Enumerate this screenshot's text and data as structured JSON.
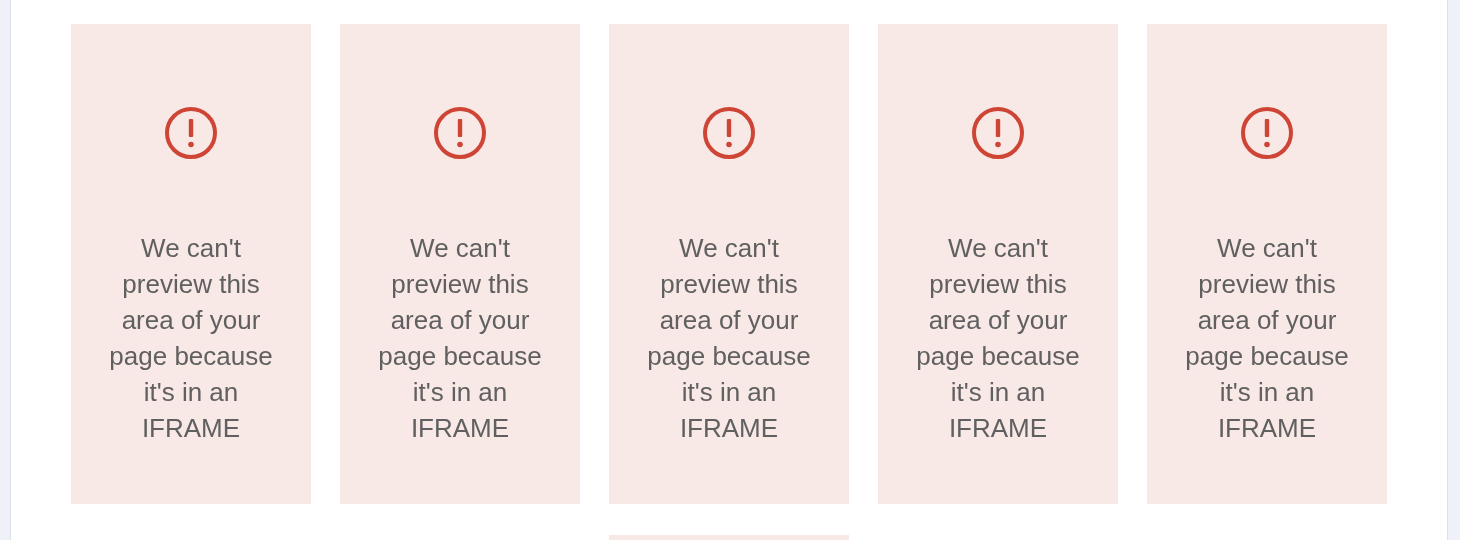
{
  "cards": [
    {
      "kind": "notice",
      "message": "We can't preview this area of your page because it's in an IFRAME"
    },
    {
      "kind": "notice",
      "message": "We can't preview this area of your page because it's in an IFRAME"
    },
    {
      "kind": "notice",
      "message": "We can't preview this area of your page because it's in an IFRAME"
    },
    {
      "kind": "notice",
      "message": "We can't preview this area of your page because it's in an IFRAME"
    },
    {
      "kind": "notice",
      "message": "We can't preview this area of your page because it's in an IFRAME"
    },
    {
      "kind": "cut"
    }
  ]
}
